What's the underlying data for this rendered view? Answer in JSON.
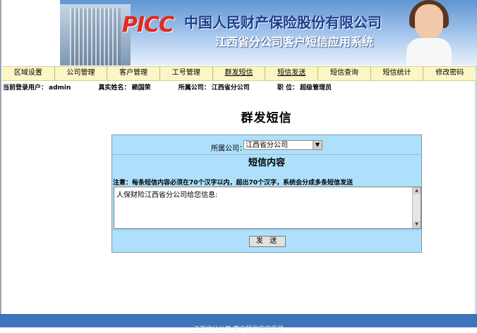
{
  "banner": {
    "logo": "PICC",
    "company": "中国人民财产保险股份有限公司",
    "system": "江西省分公司客户短信应用系统"
  },
  "nav": {
    "items": [
      {
        "label": "区域设置"
      },
      {
        "label": "公司管理"
      },
      {
        "label": "客户管理"
      },
      {
        "label": "工号管理"
      },
      {
        "label": "群发短信"
      },
      {
        "label": "短信发送"
      },
      {
        "label": "短信查询"
      },
      {
        "label": "短信统计"
      },
      {
        "label": "修改密码"
      }
    ]
  },
  "status": {
    "user_label": "当前登录用户：",
    "user": "admin",
    "realname_label": "真实姓名：",
    "realname": "赖国荣",
    "company_label": "所属公司：",
    "company": "江西省分公司",
    "role_label": "职 位：",
    "role": "超级管理员"
  },
  "page": {
    "title": "群发短信"
  },
  "form": {
    "company_label": "所属公司：",
    "company_selected": "江西省分公司",
    "content_heading": "短信内容",
    "notice": "注意：每条短信内容必须在70个汉字以内，超出70个汉字，系统会分成多条短信发送",
    "message": "人保财险江西省分公司给您信息:",
    "send_label": "发 送"
  },
  "footer": {
    "text": "江西省分公司 客户短信应用系统"
  }
}
